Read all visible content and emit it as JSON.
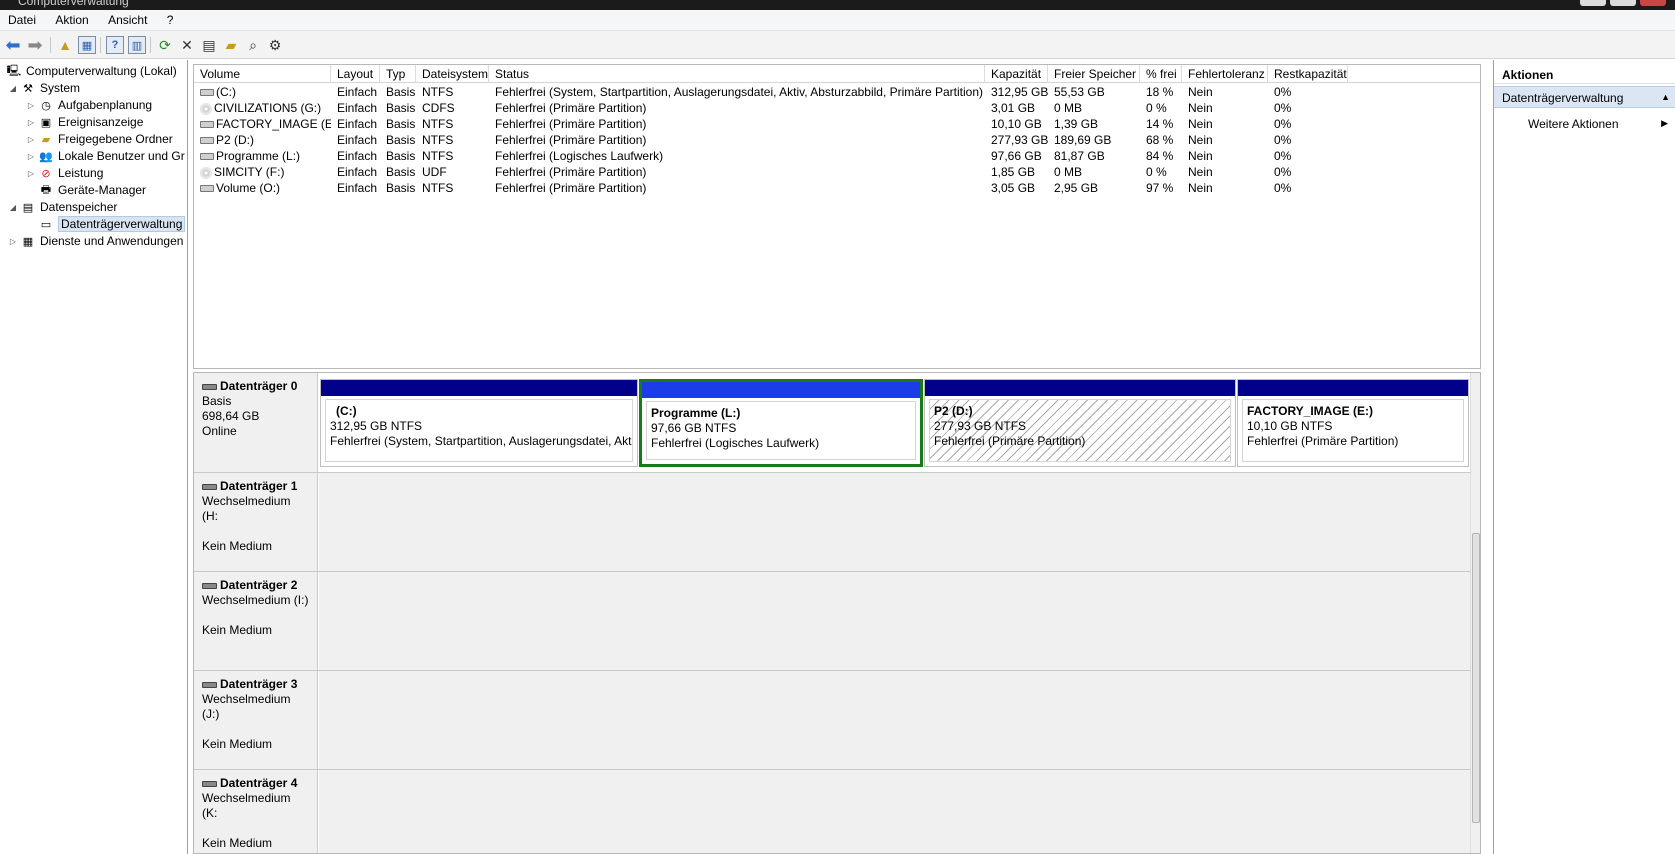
{
  "window": {
    "title": "Computerverwaltung"
  },
  "menu": [
    "Datei",
    "Aktion",
    "Ansicht",
    "?"
  ],
  "tree": {
    "root": "Computerverwaltung (Lokal)",
    "system": "System",
    "system_items": [
      "Aufgabenplanung",
      "Ereignisanzeige",
      "Freigegebene Ordner",
      "Lokale Benutzer und Gr",
      "Leistung",
      "Geräte-Manager"
    ],
    "storage": "Datenspeicher",
    "storage_items": [
      "Datenträgerverwaltung"
    ],
    "services": "Dienste und Anwendungen"
  },
  "volumes": {
    "columns": [
      "Volume",
      "Layout",
      "Typ",
      "Dateisystem",
      "Status",
      "Kapazität",
      "Freier Speicher",
      "% frei",
      "Fehlertoleranz",
      "Restkapazität"
    ],
    "rows": [
      [
        "(C:)",
        "Einfach",
        "Basis",
        "NTFS",
        "Fehlerfrei (System, Startpartition, Auslagerungsdatei, Aktiv, Absturzabbild, Primäre Partition)",
        "312,95 GB",
        "55,53 GB",
        "18 %",
        "Nein",
        "0%"
      ],
      [
        "CIVILIZATION5 (G:)",
        "Einfach",
        "Basis",
        "CDFS",
        "Fehlerfrei (Primäre Partition)",
        "3,01 GB",
        "0 MB",
        "0 %",
        "Nein",
        "0%"
      ],
      [
        "FACTORY_IMAGE (E:)",
        "Einfach",
        "Basis",
        "NTFS",
        "Fehlerfrei (Primäre Partition)",
        "10,10 GB",
        "1,39 GB",
        "14 %",
        "Nein",
        "0%"
      ],
      [
        "P2 (D:)",
        "Einfach",
        "Basis",
        "NTFS",
        "Fehlerfrei (Primäre Partition)",
        "277,93 GB",
        "189,69 GB",
        "68 %",
        "Nein",
        "0%"
      ],
      [
        "Programme (L:)",
        "Einfach",
        "Basis",
        "NTFS",
        "Fehlerfrei (Logisches Laufwerk)",
        "97,66 GB",
        "81,87 GB",
        "84 %",
        "Nein",
        "0%"
      ],
      [
        "SIMCITY (F:)",
        "Einfach",
        "Basis",
        "UDF",
        "Fehlerfrei (Primäre Partition)",
        "1,85 GB",
        "0 MB",
        "0 %",
        "Nein",
        "0%"
      ],
      [
        "Volume (O:)",
        "Einfach",
        "Basis",
        "NTFS",
        "Fehlerfrei (Primäre Partition)",
        "3,05 GB",
        "2,95 GB",
        "97 %",
        "Nein",
        "0%"
      ]
    ],
    "icons": [
      "drive-icon",
      "cd-icon",
      "drive-icon",
      "drive-icon",
      "drive-icon",
      "cd-icon",
      "drive-icon"
    ]
  },
  "disk0": {
    "name": "Datenträger 0",
    "type": "Basis",
    "size": "698,64 GB",
    "state": "Online",
    "partitions": [
      {
        "name": "(C:)",
        "size": "312,95 GB NTFS",
        "status": "Fehlerfrei (System, Startpartition, Auslagerungsdatei, Akti"
      },
      {
        "name": "Programme  (L:)",
        "size": "97,66 GB NTFS",
        "status": "Fehlerfrei (Logisches Laufwerk)"
      },
      {
        "name": "P2  (D:)",
        "size": "277,93 GB NTFS",
        "status": "Fehlerfrei (Primäre Partition)"
      },
      {
        "name": "FACTORY_IMAGE  (E:)",
        "size": "10,10 GB NTFS",
        "status": "Fehlerfrei (Primäre Partition)"
      }
    ]
  },
  "removable": [
    {
      "name": "Datenträger 1",
      "type": "Wechselmedium (H:",
      "media": "Kein Medium"
    },
    {
      "name": "Datenträger 2",
      "type": "Wechselmedium (I:)",
      "media": "Kein Medium"
    },
    {
      "name": "Datenträger 3",
      "type": "Wechselmedium (J:)",
      "media": "Kein Medium"
    },
    {
      "name": "Datenträger 4",
      "type": "Wechselmedium (K:",
      "media": "Kein Medium"
    }
  ],
  "actions": {
    "title": "Aktionen",
    "section": "Datenträgerverwaltung",
    "more": "Weitere Aktionen"
  },
  "colors": {
    "primary_partition_bar": "#00008b",
    "logical_partition_bar": "#1a3de8",
    "selection": "#1a7a1a"
  }
}
